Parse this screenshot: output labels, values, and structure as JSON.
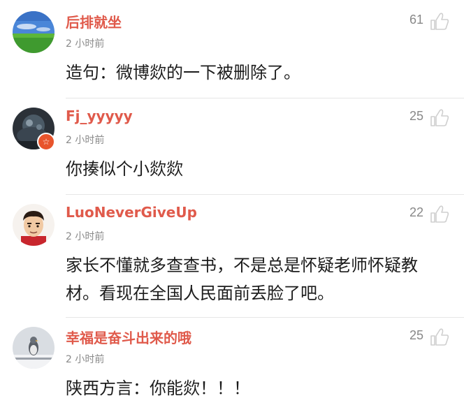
{
  "comments": [
    {
      "username": "后排就坐",
      "time": "2 小时前",
      "likes": "61",
      "text": "造句：微博欻的一下被删除了。",
      "avatar": "green-field-sky"
    },
    {
      "username": "Fj_yyyyy",
      "time": "2 小时前",
      "likes": "25",
      "text": "你揍似个小欻欻",
      "avatar": "dark-photo",
      "badge": "☆"
    },
    {
      "username": "LuoNeverGiveUp",
      "time": "2 小时前",
      "likes": "22",
      "text": "家长不懂就多查查书，不是总是怀疑老师怀疑教材。看现在全国人民面前丢脸了吧。",
      "avatar": "cartoon-face"
    },
    {
      "username": "幸福是奋斗出来的哦",
      "time": "2 小时前",
      "likes": "25",
      "text": "陕西方言：你能欻！！！",
      "avatar": "bird-on-snow"
    }
  ],
  "colors": {
    "username": "#e05a4b",
    "time": "#8a8a8a",
    "text": "#1c1c1c",
    "likes": "#888888",
    "badge": "#e8542c"
  }
}
